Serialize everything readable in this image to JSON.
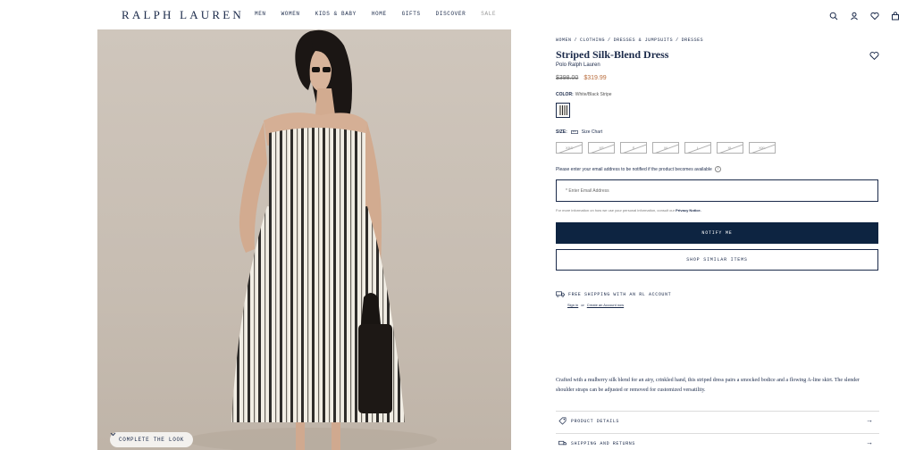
{
  "header": {
    "logo": "RALPH LAUREN",
    "nav": [
      "MEN",
      "WOMEN",
      "KIDS & BABY",
      "HOME",
      "GIFTS",
      "DISCOVER",
      "SALE"
    ],
    "icons": [
      "search-icon",
      "account-icon",
      "heart-icon",
      "bag-icon"
    ]
  },
  "hero": {
    "complete_look": "COMPLETE THE LOOK"
  },
  "breadcrumb": [
    "WOMEN",
    "/",
    "CLOTHING",
    "/",
    "DRESSES & JUMPSUITS",
    "/",
    "DRESSES"
  ],
  "product": {
    "title": "Striped Silk-Blend Dress",
    "brand": "Polo Ralph Lauren",
    "old_price": "$398.00",
    "new_price": "$319.99",
    "color_label": "COLOR:",
    "color_value": "White/Black Stripe",
    "size_label": "SIZE:",
    "size_chart": "Size Chart",
    "sizes": [
      "XXS",
      "XS",
      "S",
      "M",
      "L",
      "XL",
      "XXL"
    ]
  },
  "notify": {
    "text": "Please enter your email address to be notified if the product becomes available",
    "email_placeholder": "* Enter Email Address",
    "privacy_prefix": "For more information on how we use your personal information, consult our",
    "privacy_link": "Privacy Notice.",
    "notify_button": "NOTIFY ME",
    "similar_button": "SHOP SIMILAR ITEMS"
  },
  "shipping": {
    "title": "FREE SHIPPING WITH AN RL ACCOUNT",
    "sign_in": "Sign in",
    "or": "or",
    "create": "Create an Account now"
  },
  "description": "Crafted with a mulberry silk blend for an airy, crinkled hand, this striped dress pairs a smocked bodice and a flowing A-line skirt. The slender shoulder straps can be adjusted or removed for customized versatility.",
  "accordion": [
    {
      "label": "PRODUCT DETAILS",
      "arrow": "→"
    },
    {
      "label": "SHIPPING AND RETURNS",
      "arrow": "→"
    }
  ]
}
